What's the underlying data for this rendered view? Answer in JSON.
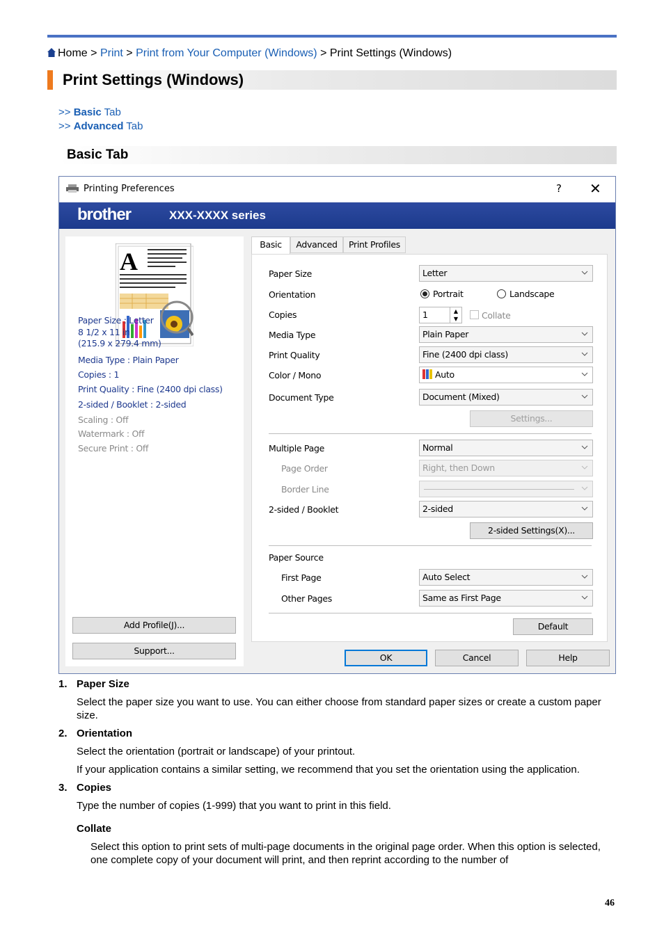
{
  "breadcrumb": {
    "home": "Home",
    "sep": ">",
    "print": "Print",
    "print_from": "Print from Your Computer (Windows)",
    "current": "Print Settings (Windows)"
  },
  "title": "Print Settings (Windows)",
  "toc": [
    {
      "prefix": ">> ",
      "bold": "Basic",
      "rest": " Tab"
    },
    {
      "prefix": ">> ",
      "bold": "Advanced",
      "rest": " Tab"
    }
  ],
  "section_title": "Basic Tab",
  "dialog": {
    "title": "Printing Preferences",
    "help": "?",
    "close": "✕",
    "brand": "brother",
    "series": "XXX-XXXX series",
    "summary": [
      "Paper Size : Letter",
      "8 1/2 x 11 in",
      "(215.9 x 279.4 mm)",
      "Media Type : Plain Paper",
      "Copies : 1",
      "Print Quality : Fine (2400 dpi class)",
      "2-sided / Booklet : 2-sided",
      "Scaling : Off",
      "Watermark : Off",
      "Secure Print : Off"
    ],
    "add_profile": "Add Profile(J)...",
    "support": "Support...",
    "tabs": [
      "Basic",
      "Advanced",
      "Print Profiles"
    ],
    "labels": {
      "paper_size": "Paper Size",
      "orientation": "Orientation",
      "copies": "Copies",
      "media_type": "Media Type",
      "print_quality": "Print Quality",
      "color_mono": "Color / Mono",
      "document_type": "Document Type",
      "multiple_page": "Multiple Page",
      "page_order": "Page Order",
      "border_line": "Border Line",
      "two_sided": "2-sided / Booklet",
      "paper_source": "Paper Source",
      "first_page": "First Page",
      "other_pages": "Other Pages"
    },
    "values": {
      "paper_size": "Letter",
      "portrait": "Portrait",
      "landscape": "Landscape",
      "copies": "1",
      "collate": "Collate",
      "media_type": "Plain Paper",
      "print_quality": "Fine (2400 dpi class)",
      "color_mono": "Auto",
      "document_type": "Document (Mixed)",
      "settings": "Settings...",
      "multiple_page": "Normal",
      "page_order": "Right, then Down",
      "two_sided": "2-sided",
      "two_sided_settings": "2-sided Settings(X)...",
      "first_page": "Auto Select",
      "other_pages": "Same as First Page",
      "default": "Default"
    },
    "ok": "OK",
    "cancel": "Cancel",
    "help_btn": "Help"
  },
  "items": [
    {
      "num": "1.",
      "title": "Paper Size",
      "text": "Select the paper size you want to use. You can either choose from standard paper sizes or create a custom paper size."
    },
    {
      "num": "2.",
      "title": "Orientation",
      "text": "Select the orientation (portrait or landscape) of your printout.",
      "text2": "If your application contains a similar setting, we recommend that you set the orientation using the application."
    },
    {
      "num": "3.",
      "title": "Copies",
      "text": "Type the number of copies (1-999) that you want to print in this field."
    }
  ],
  "collate": {
    "title": "Collate",
    "text": "Select this option to print sets of multi-page documents in the original page order. When this option is selected, one complete copy of your document will print, and then reprint according to the number of"
  },
  "page_number": "46"
}
